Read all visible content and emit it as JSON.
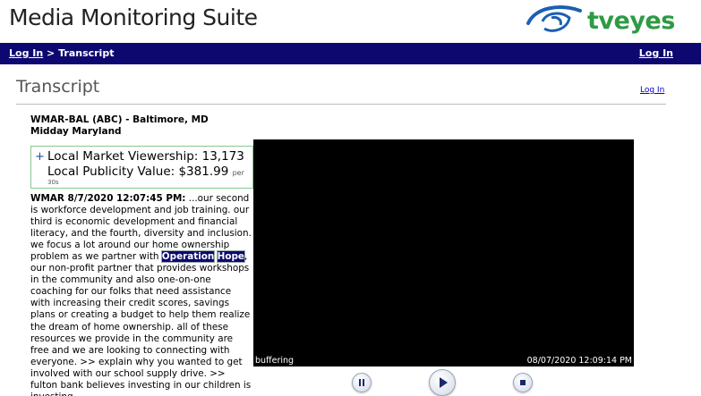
{
  "app": {
    "title": "Media Monitoring Suite",
    "logo_text": "tveyes"
  },
  "navbar": {
    "crumb_login": "Log In",
    "crumb_sep": " > ",
    "crumb_current": "Transcript",
    "login": "Log In"
  },
  "page": {
    "title": "Transcript",
    "login_link": "Log In"
  },
  "station": {
    "name": "WMAR-BAL (ABC) - Baltimore, MD",
    "program": "Midday Maryland"
  },
  "metrics": {
    "expand": "+",
    "viewership_label": "Local Market Viewership: 13,173",
    "publicity_label": "Local Publicity Value: $381.99",
    "per": "per",
    "per_unit": "30s"
  },
  "transcript": {
    "lead": "WMAR 8/7/2020 12:07:45 PM:",
    "text_before": " ...our second is workforce development and job training. our third is economic development and financial literacy, and the fourth, diversity and inclusion. we focus a lot around our home ownership problem as we partner with ",
    "hit1": "Operation",
    "hit2": "Hope",
    "text_after": ", our non-profit partner that provides workshops in the community and also one-on-one coaching for our folks that need assistance with increasing their credit scores, savings plans or creating a budget to help them realize the dream of home ownership. all of these resources we provide in the community are free and we are looking to connecting with everyone. >> explain why you wanted to get involved with our school supply drive. >> fulton bank believes investing in our children is investing"
  },
  "video": {
    "status": "buffering",
    "timestamp": "08/07/2020 12:09:14 PM"
  },
  "colors": {
    "navbar": "#0d0870",
    "logo_green": "#2f9a44",
    "logo_blue": "#1b5fb3",
    "box_border": "#88c98f"
  }
}
